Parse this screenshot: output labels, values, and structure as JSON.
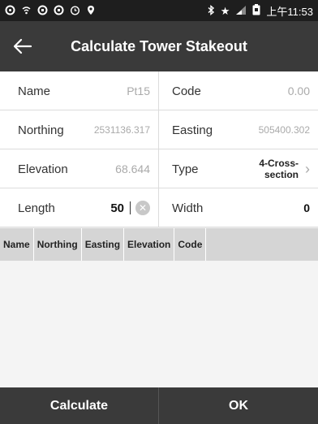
{
  "status_bar": {
    "time": "上午11:53",
    "icons_left": [
      "notification-icon",
      "wifi-hotspot-icon",
      "sync-icon",
      "sync-icon",
      "timer-icon",
      "location-icon"
    ],
    "icons_right": [
      "bluetooth-icon",
      "star-icon",
      "signal-icon",
      "battery-icon"
    ]
  },
  "titlebar": {
    "title": "Calculate Tower Stakeout"
  },
  "form": {
    "name": {
      "label": "Name",
      "value": "Pt15"
    },
    "code": {
      "label": "Code",
      "value": "0.00"
    },
    "northing": {
      "label": "Northing",
      "value": "2531136.317"
    },
    "easting": {
      "label": "Easting",
      "value": "505400.302"
    },
    "elevation": {
      "label": "Elevation",
      "value": "68.644"
    },
    "type": {
      "label": "Type",
      "value_line1": "4-Cross-",
      "value_line2": "section"
    },
    "length": {
      "label": "Length",
      "value": "50"
    },
    "width": {
      "label": "Width",
      "value": "0"
    }
  },
  "table": {
    "columns": [
      "Name",
      "Northing",
      "Easting",
      "Elevation",
      "Code"
    ]
  },
  "buttons": {
    "calculate": "Calculate",
    "ok": "OK"
  }
}
